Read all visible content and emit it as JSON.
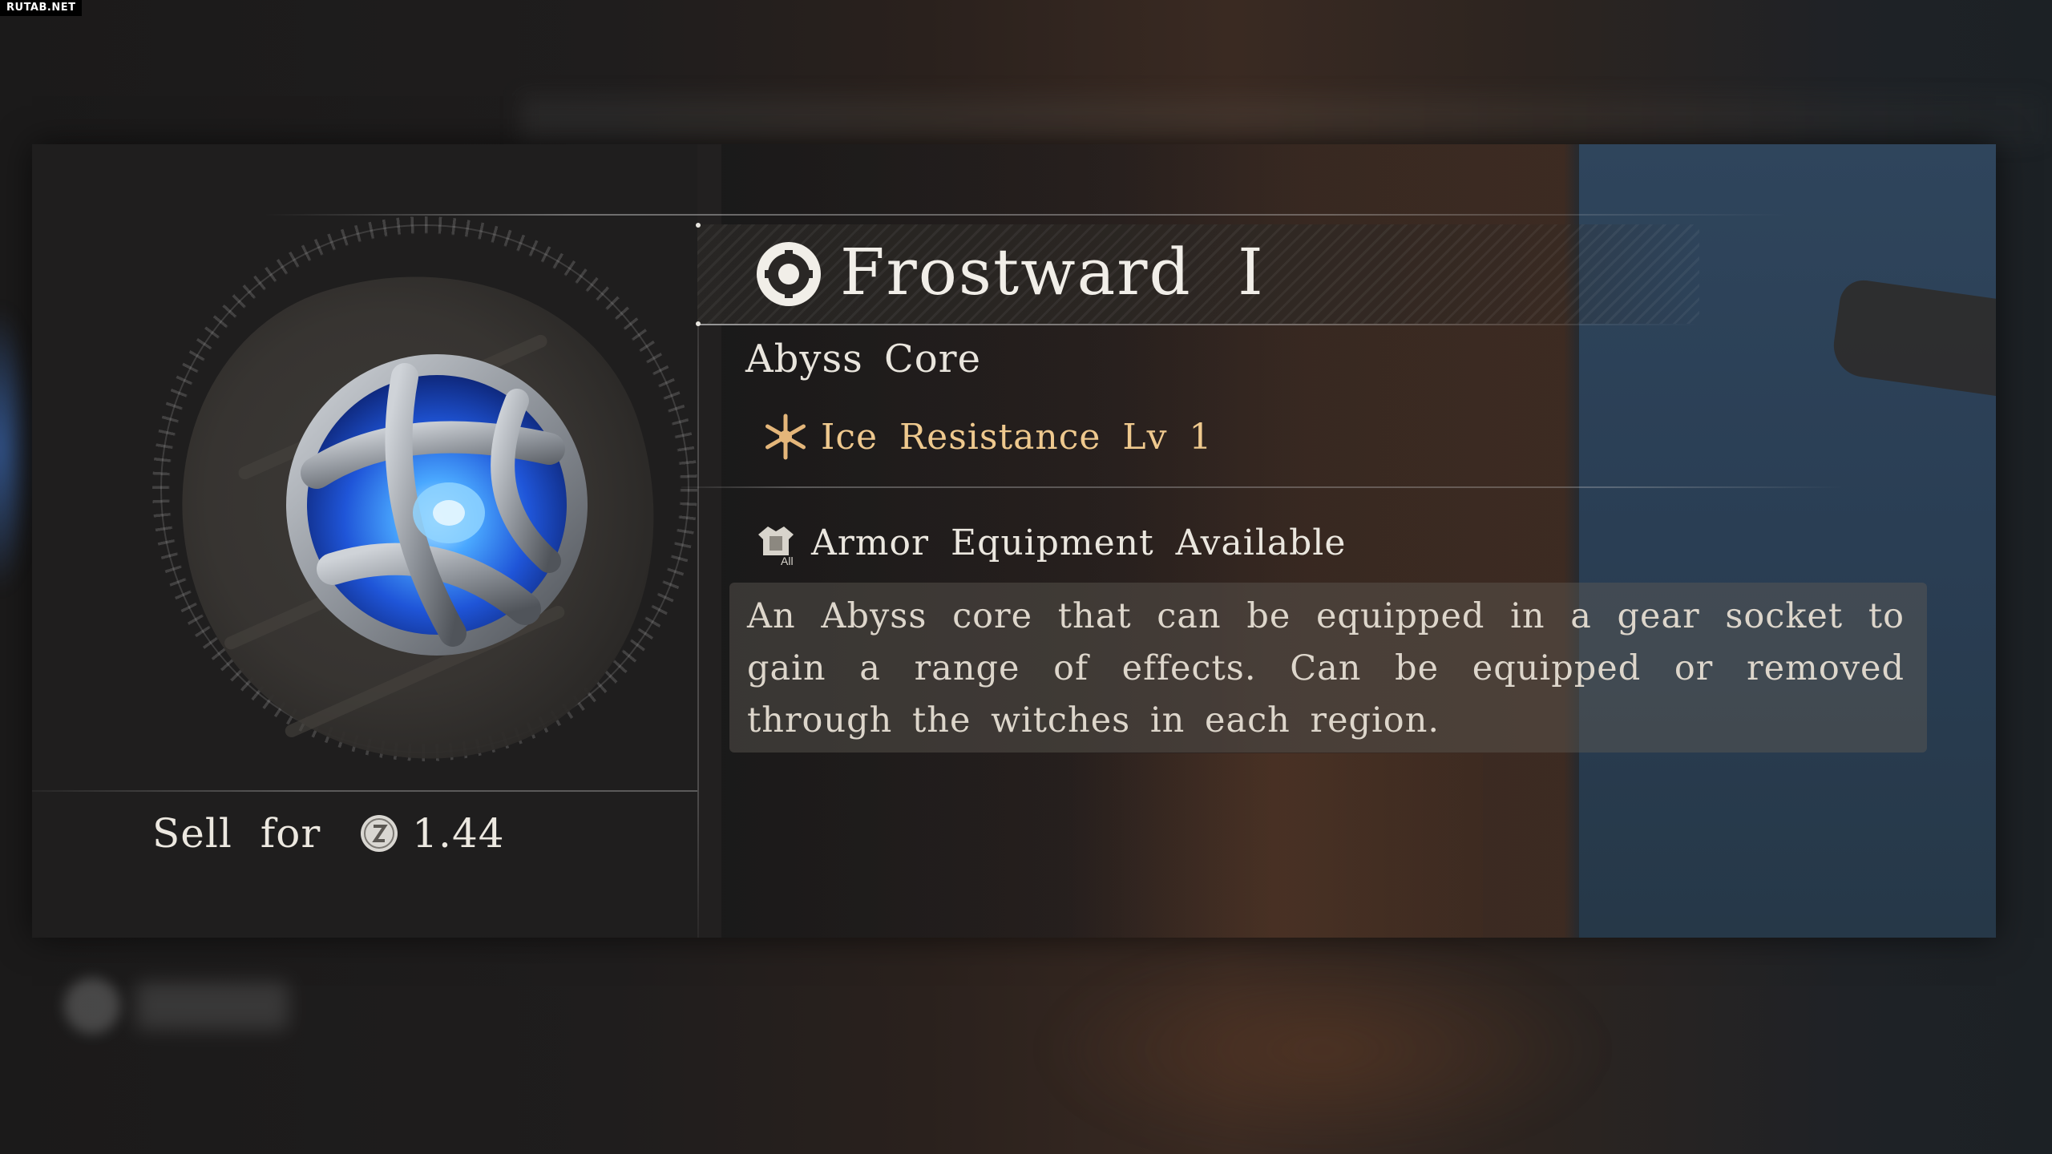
{
  "watermark": "RUTAB.NET",
  "item": {
    "name": "Frostward I",
    "type": "Abyss Core",
    "effect": "Ice Resistance Lv 1",
    "equip_availability": "Armor Equipment Available",
    "equip_icon_sublabel": "All",
    "description": "An Abyss core that can be equipped in a gear socket to gain a range of effects. Can be equipped or removed through the witches in each region."
  },
  "sell": {
    "label": "Sell for",
    "value": "1.44"
  },
  "background": {
    "blurred_value": "1.44"
  },
  "icons": {
    "title": "abyss-core-type-icon",
    "effect": "snowflake-icon",
    "equip": "armor-icon",
    "currency": "silver-coin-icon",
    "item": "abyss-core-orb-icon"
  },
  "colors": {
    "title_text": "#f1eee8",
    "effect_text": "#efc98e",
    "body_text": "#ddd6cb",
    "orb_glow": "#2f7dff"
  }
}
